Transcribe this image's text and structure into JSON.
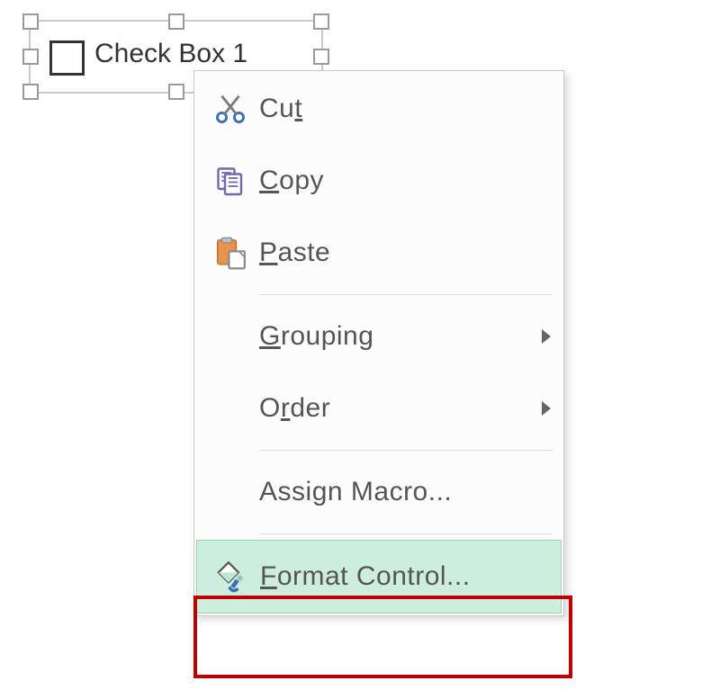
{
  "control": {
    "label": "Check Box 1"
  },
  "menu": {
    "cut": {
      "pre": "Cu",
      "u": "t",
      "post": ""
    },
    "copy": {
      "pre": "",
      "u": "C",
      "post": "opy"
    },
    "paste": {
      "pre": "",
      "u": "P",
      "post": "aste"
    },
    "grouping": {
      "pre": "",
      "u": "G",
      "post": "rouping"
    },
    "order": {
      "pre": "O",
      "u": "r",
      "post": "der"
    },
    "assign_macro": {
      "pre": "Assi",
      "u": "g",
      "post": "n Macro..."
    },
    "format_control": {
      "pre": "",
      "u": "F",
      "post": "ormat Control..."
    }
  }
}
